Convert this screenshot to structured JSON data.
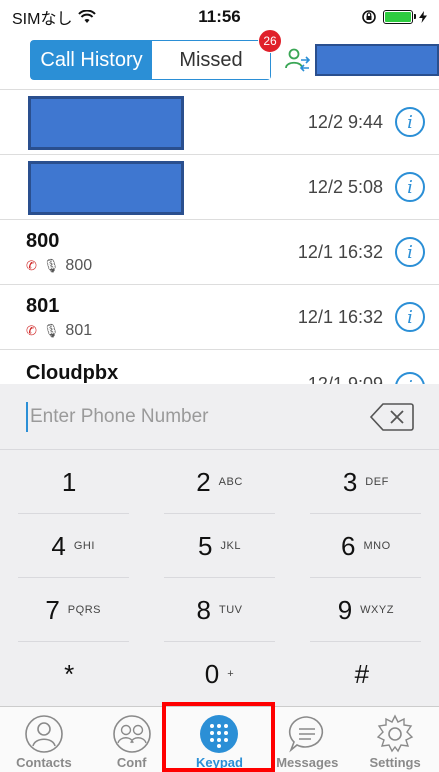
{
  "status_bar": {
    "carrier": "SIMなし",
    "time": "11:56"
  },
  "header": {
    "tabs": [
      {
        "label": "Call History",
        "active": true
      },
      {
        "label": "Missed",
        "active": false
      }
    ],
    "missed_badge": "26"
  },
  "calls": [
    {
      "name": "",
      "number": "",
      "time": "12/2 9:44",
      "redacted": true
    },
    {
      "name": "",
      "number": "",
      "time": "12/2 5:08",
      "redacted": true
    },
    {
      "name": "800",
      "number": "800",
      "time": "12/1 16:32",
      "redacted": false
    },
    {
      "name": "801",
      "number": "801",
      "time": "12/1 16:32",
      "redacted": false
    },
    {
      "name": "Cloudpbx",
      "number": "",
      "time": "12/1 9:09",
      "redacted": false
    }
  ],
  "keypad": {
    "placeholder": "Enter Phone Number",
    "keys": [
      {
        "digit": "1",
        "letters": ""
      },
      {
        "digit": "2",
        "letters": "ABC"
      },
      {
        "digit": "3",
        "letters": "DEF"
      },
      {
        "digit": "4",
        "letters": "GHI"
      },
      {
        "digit": "5",
        "letters": "JKL"
      },
      {
        "digit": "6",
        "letters": "MNO"
      },
      {
        "digit": "7",
        "letters": "PQRS"
      },
      {
        "digit": "8",
        "letters": "TUV"
      },
      {
        "digit": "9",
        "letters": "WXYZ"
      },
      {
        "digit": "*",
        "letters": ""
      },
      {
        "digit": "0",
        "letters": "+"
      },
      {
        "digit": "#",
        "letters": ""
      }
    ]
  },
  "tab_bar": {
    "items": [
      {
        "label": "Contacts",
        "icon": "contacts-icon",
        "active": false
      },
      {
        "label": "Conf",
        "icon": "conference-icon",
        "active": false
      },
      {
        "label": "Keypad",
        "icon": "keypad-icon",
        "active": true
      },
      {
        "label": "Messages",
        "icon": "messages-icon",
        "active": false
      },
      {
        "label": "Settings",
        "icon": "settings-icon",
        "active": false
      }
    ]
  },
  "colors": {
    "accent": "#2b8fd6",
    "badge": "#e0202a",
    "highlight": "#ff0000",
    "redaction": "#3f77d0"
  }
}
